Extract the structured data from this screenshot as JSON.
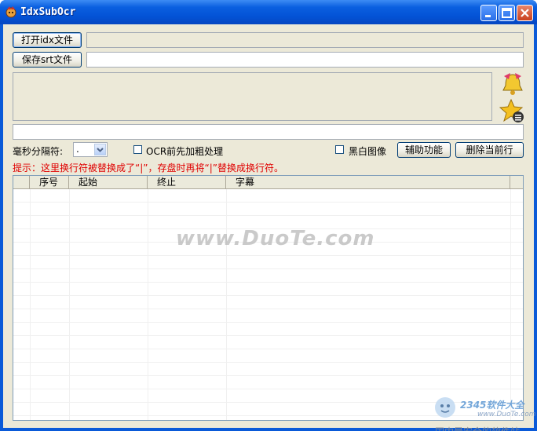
{
  "window": {
    "title": "IdxSubOcr"
  },
  "toolbar": {
    "open_idx_label": "打开idx文件",
    "save_srt_label": "保存srt文件"
  },
  "options": {
    "ms_separator_label": "毫秒分隔符:",
    "ms_separator_value": ".",
    "ocr_bold_label": "OCR前先加粗处理",
    "ocr_bold_checked": false,
    "bw_image_label": "黑白图像",
    "bw_image_checked": false,
    "assist_button": "辅助功能",
    "delete_row_button": "删除当前行"
  },
  "hint": "提示：这里换行符被替换成了“|”，存盘时再将“|”替换成换行符。",
  "table": {
    "columns": [
      "序号",
      "起始",
      "终止",
      "字幕"
    ],
    "rows": []
  },
  "watermark": "www.DuoTe.com",
  "corner_badge": {
    "brand": "2345软件大全",
    "url": "www.DuoTe.com",
    "tagline": "国内最安全的软件站"
  }
}
